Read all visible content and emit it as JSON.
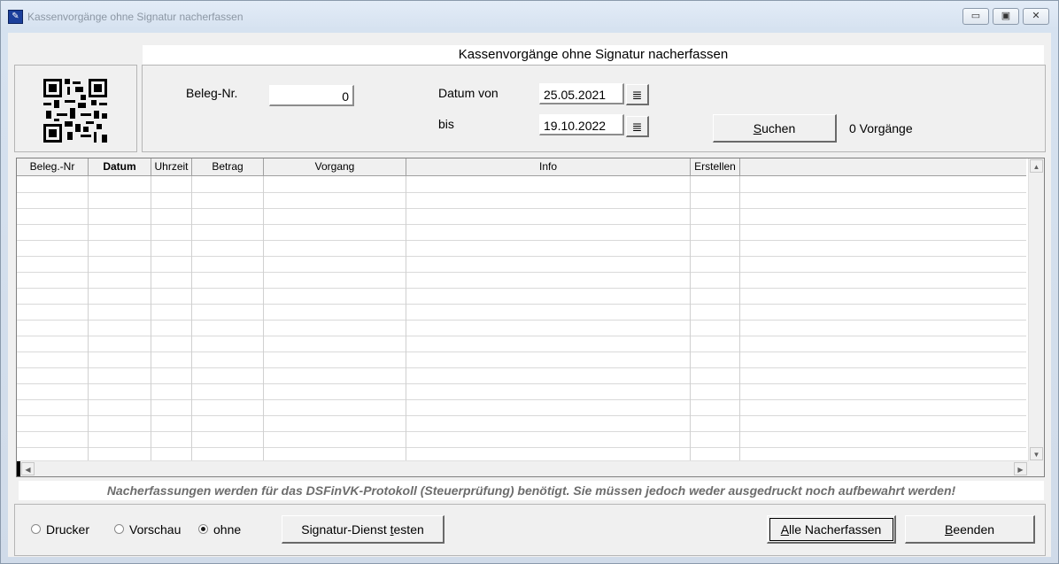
{
  "window": {
    "title": "Kassenvorgänge ohne Signatur nacherfassen",
    "minimize": "▭",
    "maximize": "▣",
    "close": "✕"
  },
  "heading": "Kassenvorgänge ohne Signatur nacherfassen",
  "search": {
    "beleg_label": "Beleg-Nr.",
    "beleg_value": "0",
    "datum_von_label": "Datum von",
    "datum_von_value": "25.05.2021",
    "bis_label": "bis",
    "bis_value": "19.10.2022",
    "calendar_glyph": "≣",
    "suchen_first": "S",
    "suchen_rest": "uchen",
    "count_text": "0 Vorgänge"
  },
  "table": {
    "columns": [
      "Beleg.-Nr",
      "Datum",
      "Uhrzeit",
      "Betrag",
      "Vorgang",
      "Info",
      "Erstellen"
    ],
    "rows": []
  },
  "notice": "Nacherfassungen werden für das DSFinVK-Protokoll (Steuerprüfung) benötigt. Sie müssen jedoch weder ausgedruckt noch aufbewahrt werden!",
  "output": {
    "options": [
      "Drucker",
      "Vorschau",
      "ohne"
    ],
    "selected": "ohne"
  },
  "buttons": {
    "signatur_pre": "Signatur-Dienst ",
    "signatur_ul": "t",
    "signatur_post": "esten",
    "alle_first": "A",
    "alle_rest": "lle Nacherfassen",
    "beenden_first": "B",
    "beenden_rest": "eenden"
  }
}
